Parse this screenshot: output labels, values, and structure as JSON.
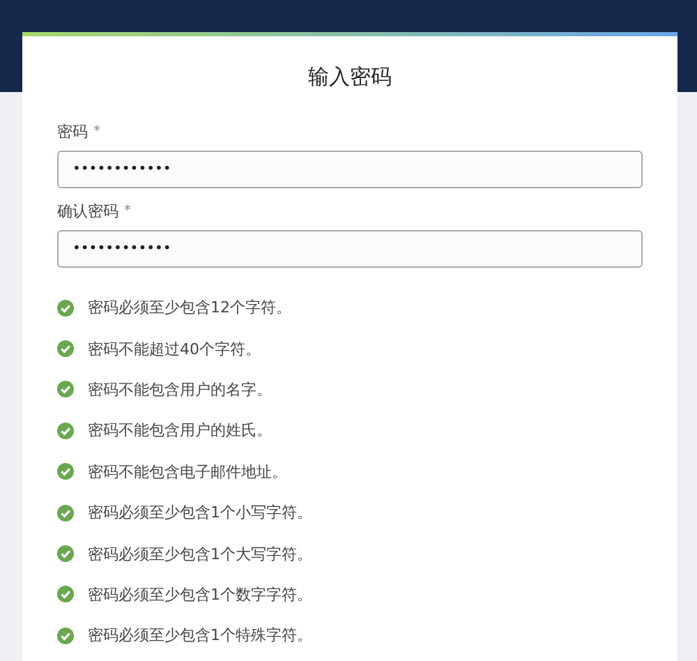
{
  "title": "输入密码",
  "fields": [
    {
      "label": "密码",
      "required_mark": "*",
      "value": "••••••••••••"
    },
    {
      "label": "确认密码",
      "required_mark": "*",
      "value": "••••••••••••"
    }
  ],
  "rules": [
    {
      "text": "密码必须至少包含12个字符。",
      "met": true
    },
    {
      "text": "密码不能超过40个字符。",
      "met": true
    },
    {
      "text": "密码不能包含用户的名字。",
      "met": true
    },
    {
      "text": "密码不能包含用户的姓氏。",
      "met": true
    },
    {
      "text": "密码不能包含电子邮件地址。",
      "met": true
    },
    {
      "text": "密码必须至少包含1个小写字符。",
      "met": true
    },
    {
      "text": "密码必须至少包含1个大写字符。",
      "met": true
    },
    {
      "text": "密码必须至少包含1个数字字符。",
      "met": true
    },
    {
      "text": "密码必须至少包含1个特殊字符。",
      "met": true
    }
  ]
}
